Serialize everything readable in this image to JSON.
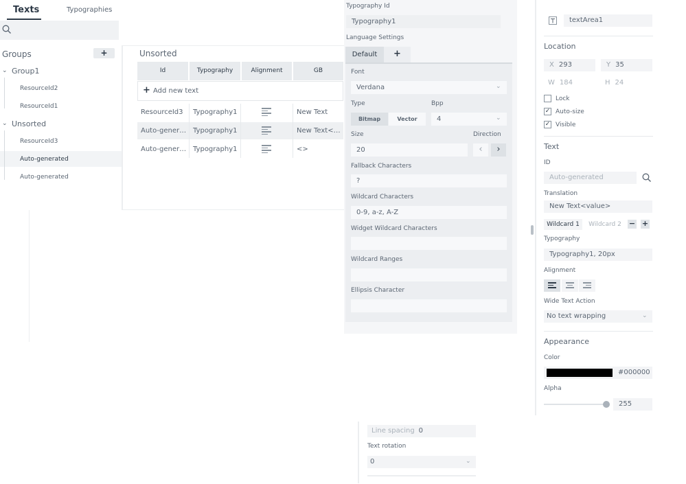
{
  "left_panel": {
    "tabs": [
      "Texts",
      "Typographies"
    ],
    "groups_label": "Groups",
    "add_group_label": "+",
    "groups": [
      {
        "name": "Group1",
        "items": [
          "ResourceId2",
          "ResourceId1"
        ]
      },
      {
        "name": "Unsorted",
        "items": [
          "ResourceId3",
          "Auto-generated",
          "Auto-generated"
        ]
      }
    ]
  },
  "table": {
    "title": "Unsorted",
    "columns": [
      "Id",
      "Typography",
      "Alignment",
      "GB"
    ],
    "add_new_label": "Add new text",
    "rows": [
      {
        "id": "ResourceId3",
        "typography": "Typography1",
        "gb": "New Text"
      },
      {
        "id": "Auto-genera...",
        "typography": "Typography1",
        "gb": "New Text<va..."
      },
      {
        "id": "Auto-genera...",
        "typography": "Typography1",
        "gb": "<>"
      }
    ]
  },
  "typography_panel": {
    "typography_id_label": "Typography Id",
    "typography_id_value": "Typography1",
    "language_settings_label": "Language Settings",
    "language_tabs": [
      "Default",
      "+"
    ],
    "font_label": "Font",
    "font_value": "Verdana",
    "type_label": "Type",
    "type_options": [
      "Bitmap",
      "Vector"
    ],
    "bpp_label": "Bpp",
    "bpp_value": "4",
    "size_label": "Size",
    "size_value": "20",
    "direction_label": "Direction",
    "fallback_label": "Fallback Characters",
    "fallback_value": "?",
    "wildcard_label": "Wildcard Characters",
    "wildcard_value": "0-9, a-z, A-Z",
    "widget_wildcard_label": "Widget Wildcard Characters",
    "widget_wildcard_value": "",
    "wildcard_ranges_label": "Wildcard Ranges",
    "wildcard_ranges_value": "",
    "ellipsis_label": "Ellipsis Character",
    "ellipsis_value": ""
  },
  "properties": {
    "name": "textArea1",
    "location_label": "Location",
    "x_label": "X",
    "x_value": "293",
    "y_label": "Y",
    "y_value": "35",
    "w_label": "W",
    "w_value": "184",
    "h_label": "H",
    "h_value": "24",
    "lock_label": "Lock",
    "autosize_label": "Auto-size",
    "visible_label": "Visible",
    "text_section": "Text",
    "id_label": "ID",
    "id_placeholder": "Auto-generated",
    "translation_label": "Translation",
    "translation_value": "New Text<value>",
    "wildcard_tabs": [
      "Wildcard 1",
      "Wildcard 2"
    ],
    "typography_label": "Typography",
    "typography_value": "Typography1, 20px",
    "alignment_label": "Alignment",
    "wide_text_label": "Wide Text Action",
    "wide_text_value": "No text wrapping",
    "appearance_label": "Appearance",
    "color_label": "Color",
    "color_value": "#000000",
    "alpha_label": "Alpha",
    "alpha_value": "255",
    "alpha_fraction": 1.0
  },
  "bottom_panel": {
    "line_spacing_label": "Line spacing",
    "line_spacing_value": "0",
    "text_rotation_label": "Text rotation",
    "text_rotation_value": "0"
  },
  "colors": {
    "accent_dark": "#2e3a47",
    "text_muted": "#5a6572",
    "panel_bg": "#f5f6f8",
    "swatch": "#000000"
  }
}
